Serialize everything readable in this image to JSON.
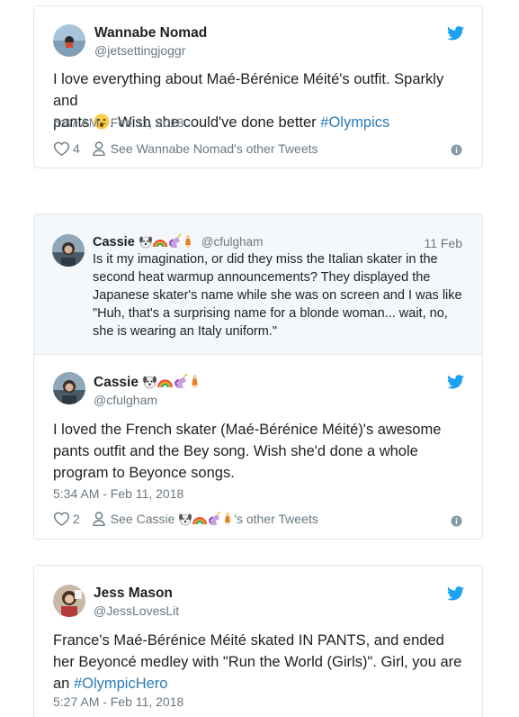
{
  "tweet1": {
    "name": "Wannabe Nomad",
    "handle": "@jetsettingjoggr",
    "text_a": "I love everything about Maé-Bérénice Méité's outfit. Sparkly and",
    "text_b": "pants",
    "text_c": ". Wish she could've done better",
    "hashtag": "#Olympics",
    "time": "5:37 AM - Feb 11, 2018",
    "likes": "4",
    "see_other": "See Wannabe Nomad's other Tweets"
  },
  "tweet2": {
    "quote": {
      "name": "Cassie",
      "handle": "@cfulgham",
      "date": "11 Feb",
      "text": "Is it my imagination, or did they miss the Italian skater in the second heat warmup announcements? They displayed the Japanese skater's name while she was on screen and I was like \"Huh, that's a surprising name for a blonde woman... wait, no, she is wearing an Italy uniform.\""
    },
    "name": "Cassie",
    "handle": "@cfulgham",
    "text": "I loved the French skater (Maé-Bérénice Méité)'s awesome pants outfit and the Bey song. Wish she'd done a whole program to Beyonce songs.",
    "time": "5:34 AM - Feb 11, 2018",
    "likes": "2",
    "see_prefix": "See Cassie",
    "see_suffix": "'s other Tweets"
  },
  "tweet3": {
    "name": "Jess Mason",
    "handle": "@JessLovesLit",
    "text": "France's Maé-Bérénice Méité skated IN PANTS, and ended her Beyoncé medley with \"Run the World (Girls)\". Girl, you are an",
    "hashtag": "#OlympicHero",
    "time": "5:27 AM - Feb 11, 2018"
  },
  "icons": {
    "bird": "twitter-bird-icon",
    "heart": "heart-icon",
    "person": "person-icon",
    "info": "info-icon",
    "emoji_set": [
      "dog-face",
      "rainbow",
      "unicorn",
      "woman-fairy"
    ],
    "surprised": "surprised-face-emoji"
  },
  "colors": {
    "twitter_blue": "#1da1f2",
    "link": "#2b7bb9",
    "muted": "#697882",
    "border": "#e1e8ed",
    "quote_bg": "#f5f8fa"
  }
}
